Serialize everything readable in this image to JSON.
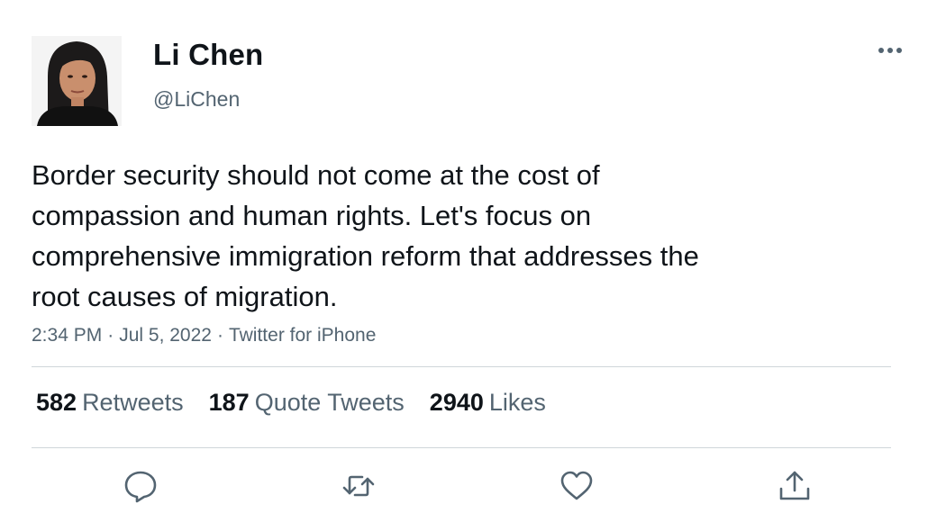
{
  "user": {
    "display_name": "Li Chen",
    "handle": "@LiChen",
    "avatar_icon": "user-photo"
  },
  "tweet": {
    "text_lines": [
      "Border security should not come at the cost of",
      "compassion and human rights. Let's focus on",
      "comprehensive immigration reform that addresses the",
      "root causes of migration."
    ],
    "time": "2:34 PM",
    "separator": "·",
    "date": "Jul 5, 2022",
    "source": "Twitter for iPhone"
  },
  "stats": {
    "retweets_count": "582",
    "retweets_label": "Retweets",
    "quotes_count": "187",
    "quotes_label": "Quote Tweets",
    "likes_count": "2940",
    "likes_label": "Likes"
  },
  "actions": {
    "reply_icon": "reply-icon",
    "retweet_icon": "retweet-icon",
    "like_icon": "heart-icon",
    "share_icon": "share-icon"
  },
  "colors": {
    "text_primary": "#0f1419",
    "text_secondary": "#536471",
    "divider": "#d0d6da",
    "icon": "#536471"
  }
}
